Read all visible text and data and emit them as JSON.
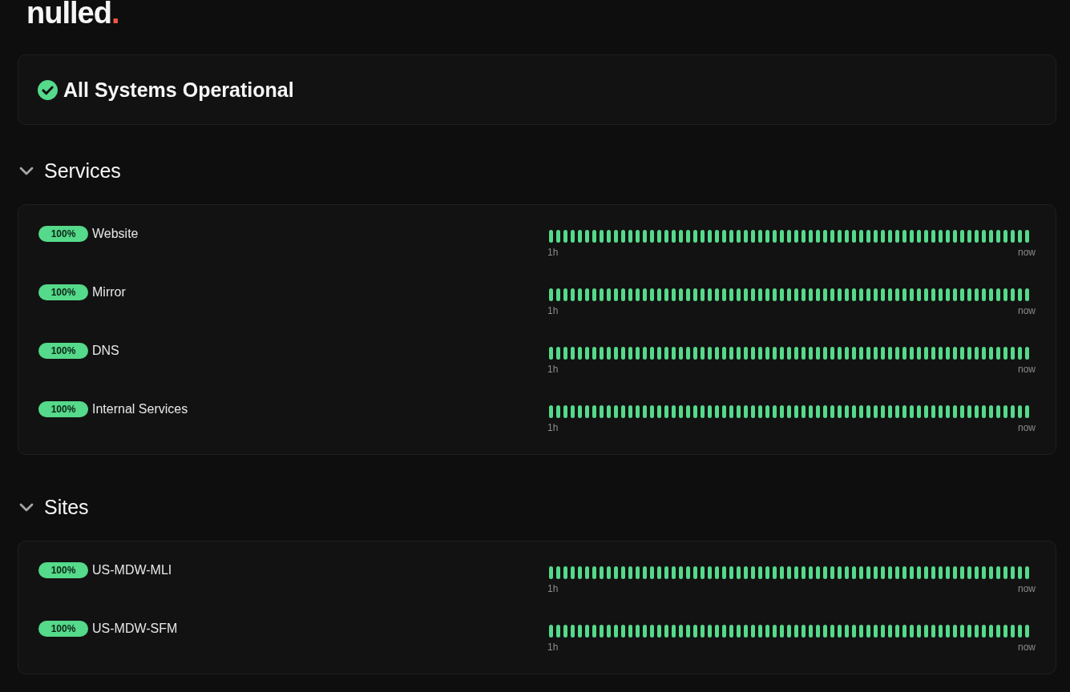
{
  "logo": {
    "name": "nulled",
    "accent": "."
  },
  "summary": {
    "operational": true,
    "text": "All Systems Operational"
  },
  "sections": [
    {
      "title": "Services",
      "expanded": true,
      "monitors": [
        {
          "uptime": "100%",
          "name": "Website",
          "up": true,
          "range_start": "1h",
          "range_end": "now"
        },
        {
          "uptime": "100%",
          "name": "Mirror",
          "up": true,
          "range_start": "1h",
          "range_end": "now"
        },
        {
          "uptime": "100%",
          "name": "DNS",
          "up": true,
          "range_start": "1h",
          "range_end": "now"
        },
        {
          "uptime": "100%",
          "name": "Internal Services",
          "up": true,
          "range_start": "1h",
          "range_end": "now"
        }
      ]
    },
    {
      "title": "Sites",
      "expanded": true,
      "monitors": [
        {
          "uptime": "100%",
          "name": "US-MDW-MLI",
          "up": true,
          "range_start": "1h",
          "range_end": "now"
        },
        {
          "uptime": "100%",
          "name": "US-MDW-SFM",
          "up": true,
          "range_start": "1h",
          "range_end": "now"
        }
      ]
    }
  ]
}
